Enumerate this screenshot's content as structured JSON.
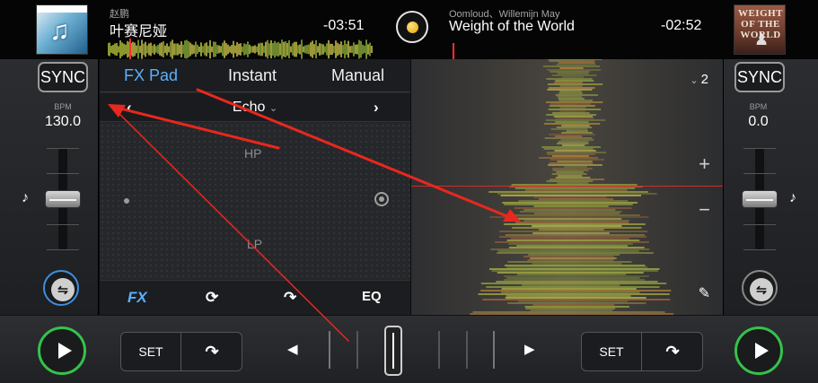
{
  "deck_a": {
    "artist": "赵鹏",
    "title": "叶赛尼娅",
    "remaining_time": "-03:51",
    "sync_label": "SYNC",
    "bpm_label": "BPM",
    "bpm_value": "130.0",
    "cover_icon": "music-note-icon"
  },
  "deck_b": {
    "artist": "Oomloud、Willemijn May",
    "title": "Weight of the World",
    "remaining_time": "-02:52",
    "sync_label": "SYNC",
    "bpm_label": "BPM",
    "bpm_value": "0.0",
    "cover_text": "WEIGHT OF THE WORLD"
  },
  "fx_panel": {
    "tabs": [
      {
        "label": "FX Pad",
        "active": true
      },
      {
        "label": "Instant",
        "active": false
      },
      {
        "label": "Manual",
        "active": false
      }
    ],
    "prev_icon": "‹",
    "next_icon": "›",
    "selected_effect": "Echo",
    "pad_top_label": "HP",
    "pad_bottom_label": "LP",
    "bottom_buttons": {
      "fx": "FX",
      "loop": "loop-icon",
      "jump": "jump-icon",
      "eq": "EQ"
    }
  },
  "waveform_view": {
    "zoom_level": "2",
    "zoom_in": "+",
    "zoom_out": "−",
    "edit_icon": "pencil-icon"
  },
  "transport": {
    "left_cue_set": "SET",
    "right_cue_set": "SET",
    "nudge_left": "◀",
    "nudge_right": "▶"
  },
  "colors": {
    "accent_blue": "#5ab0ff",
    "play_green": "#35c24a",
    "annotation_red": "#e8281e",
    "waveform_yellow": "#d8e04a"
  }
}
